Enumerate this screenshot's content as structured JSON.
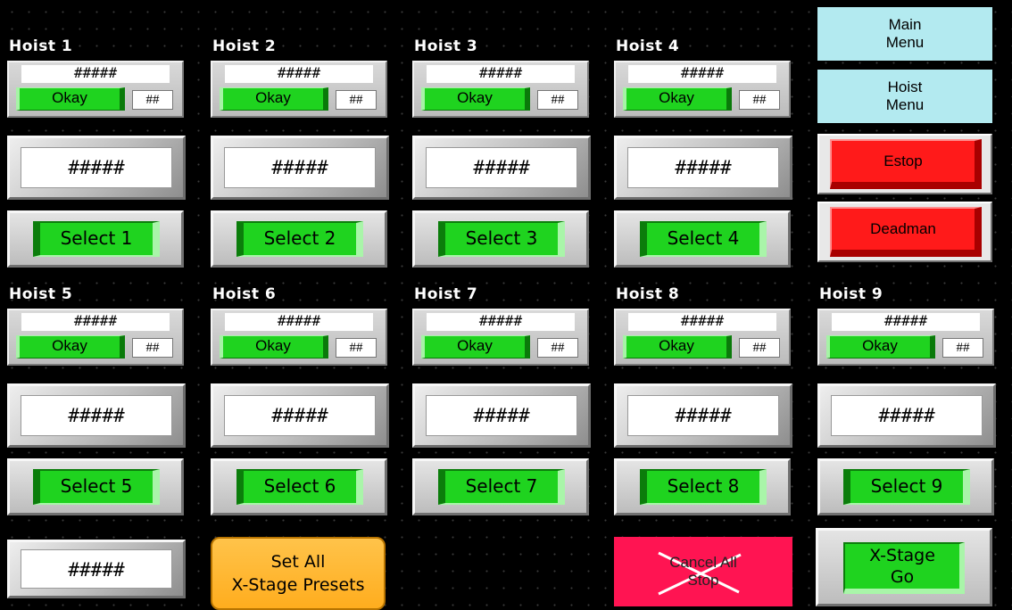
{
  "hoists": [
    {
      "title": "Hoist 1",
      "small_value": "#####",
      "status": "Okay",
      "num": "##",
      "big_value": "#####",
      "select_label": "Select 1"
    },
    {
      "title": "Hoist 2",
      "small_value": "#####",
      "status": "Okay",
      "num": "##",
      "big_value": "#####",
      "select_label": "Select 2"
    },
    {
      "title": "Hoist 3",
      "small_value": "#####",
      "status": "Okay",
      "num": "##",
      "big_value": "#####",
      "select_label": "Select 3"
    },
    {
      "title": "Hoist 4",
      "small_value": "#####",
      "status": "Okay",
      "num": "##",
      "big_value": "#####",
      "select_label": "Select 4"
    },
    {
      "title": "Hoist 5",
      "small_value": "#####",
      "status": "Okay",
      "num": "##",
      "big_value": "#####",
      "select_label": "Select 5"
    },
    {
      "title": "Hoist 6",
      "small_value": "#####",
      "status": "Okay",
      "num": "##",
      "big_value": "#####",
      "select_label": "Select 6"
    },
    {
      "title": "Hoist 7",
      "small_value": "#####",
      "status": "Okay",
      "num": "##",
      "big_value": "#####",
      "select_label": "Select 7"
    },
    {
      "title": "Hoist 8",
      "small_value": "#####",
      "status": "Okay",
      "num": "##",
      "big_value": "#####",
      "select_label": "Select 8"
    },
    {
      "title": "Hoist 9",
      "small_value": "#####",
      "status": "Okay",
      "num": "##",
      "big_value": "#####",
      "select_label": "Select 9"
    }
  ],
  "menu": {
    "main_menu": [
      "Main",
      "Menu"
    ],
    "hoist_menu": [
      "Hoist",
      "Menu"
    ],
    "estop": "Estop",
    "deadman": "Deadman"
  },
  "bottom": {
    "preset_value": "#####",
    "set_all": [
      "Set All",
      "X-Stage Presets"
    ],
    "cancel_all": [
      "Cancel All",
      "Stop"
    ],
    "xstage_go": [
      "X-Stage",
      "Go"
    ]
  },
  "colors": {
    "status_green": "#1fd31f",
    "menu_cyan": "#b3eaf0",
    "estop_red": "#ff1a1a",
    "set_all_orange": "#ffad1e",
    "cancel_pink": "#ff1452"
  }
}
